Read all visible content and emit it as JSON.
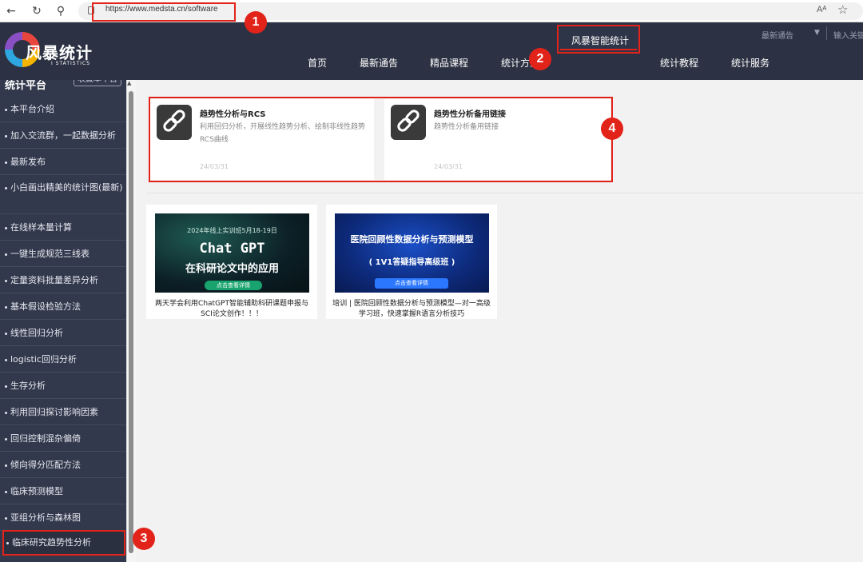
{
  "browser": {
    "url": "https://www.medsta.cn/software",
    "reader_label": "Aᴬ"
  },
  "header": {
    "logo_name": "风暴统计",
    "logo_sub": "I STATISTICS",
    "notice_label": "最新通告",
    "search_placeholder": "输入关键",
    "nav": [
      "首页",
      "最新通告",
      "精品课程",
      "统计方法",
      "风暴智能统计",
      "统计教程",
      "统计服务"
    ],
    "active_nav": "风暴智能统计"
  },
  "sidebar": {
    "title": "统计平台",
    "fav_button": "收藏本平台",
    "items": [
      "本平台介绍",
      "加入交流群，一起数据分析",
      "最新发布",
      "小白画出精美的统计图(最新)",
      "在线样本量计算",
      "一键生成规范三线表",
      "定量资料批量差异分析",
      "基本假设检验方法",
      "线性回归分析",
      "logistic回归分析",
      "生存分析",
      "利用回归探讨影响因素",
      "回归控制混杂偏倚",
      "倾向得分匹配方法",
      "临床预测模型",
      "亚组分析与森林图",
      "临床研究趋势性分析"
    ],
    "active_item": "临床研究趋势性分析"
  },
  "cards": [
    {
      "title": "趋势性分析与RCS",
      "desc": "利用回归分析，开展线性趋势分析、绘制非线性趋势RCS曲线",
      "date": "24/03/31",
      "icon": "link-icon"
    },
    {
      "title": "趋势性分析备用链接",
      "desc": "趋势性分析备用链接",
      "date": "24/03/31",
      "icon": "link-icon"
    }
  ],
  "promos": [
    {
      "img_line1": "2024年线上实训班5月18-19日",
      "img_line2": "Chat GPT",
      "img_line3": "在科研论文中的应用",
      "img_button": "点击查看详情",
      "caption": "两天学会利用ChatGPT智能辅助科研课题申报与SCI论文创作！！！"
    },
    {
      "img_line1": "医院回顾性数据分析与预测模型",
      "img_line2": "( 1V1答疑指导高级班 )",
      "img_button": "点击查看详情",
      "caption": "培训 | 医院回顾性数据分析与预测模型—对一高级学习班，快速掌握R语言分析技巧"
    }
  ],
  "annotations": [
    "1",
    "2",
    "3",
    "4"
  ],
  "colors": {
    "accent_red": "#e2231a",
    "header_bg": "#2c3243",
    "sidebar_bg": "#33394c"
  }
}
